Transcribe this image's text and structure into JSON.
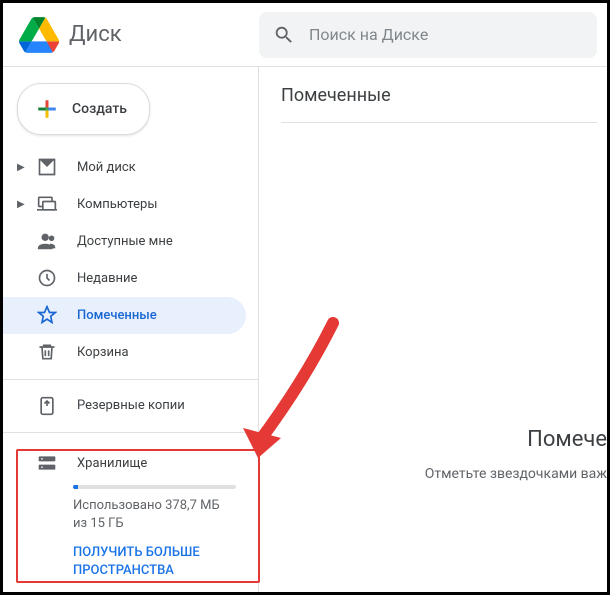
{
  "app_name": "Диск",
  "search": {
    "placeholder": "Поиск на Диске"
  },
  "create_label": "Создать",
  "nav": {
    "my_drive": "Мой диск",
    "computers": "Компьютеры",
    "shared": "Доступные мне",
    "recent": "Недавние",
    "starred": "Помеченные",
    "trash": "Корзина",
    "backups": "Резервные копии"
  },
  "storage": {
    "title": "Хранилище",
    "used_text": "Использовано 378,7 МБ из 15 ГБ",
    "link": "ПОЛУЧИТЬ БОЛЬШЕ ПРОСТРАНСТВА",
    "used_percent": 3
  },
  "main": {
    "title": "Помеченные",
    "empty_title": "Помече",
    "empty_sub": "Отметьте звездочками важ"
  }
}
